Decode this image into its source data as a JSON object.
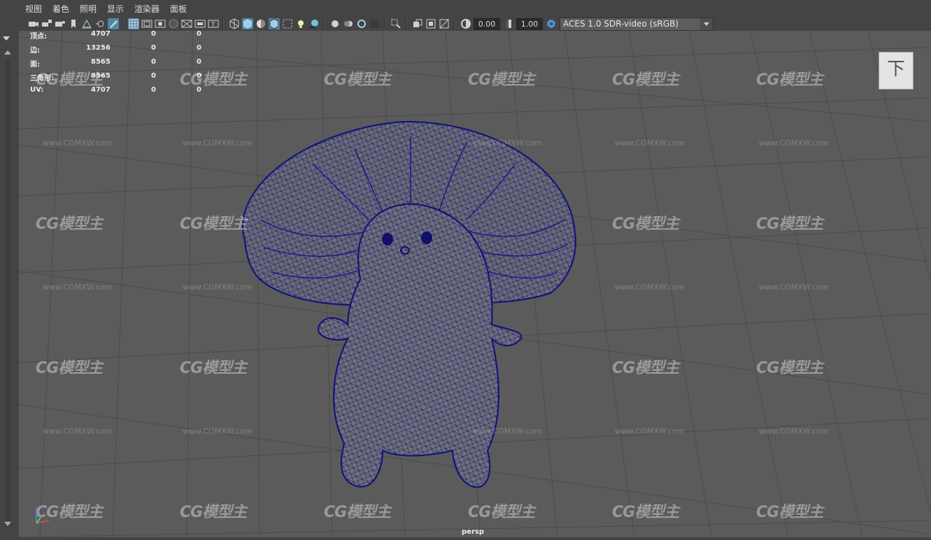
{
  "menubar": {
    "items": [
      "视图",
      "着色",
      "照明",
      "显示",
      "渲染器",
      "面板"
    ]
  },
  "toolbar": {
    "icons": [
      "camera-icon",
      "camera-lock-icon",
      "camera-attributes-icon",
      "bookmark-icon",
      "image-plane-icon",
      "pan-zoom-icon",
      "grease-pencil-icon",
      "grid-icon",
      "film-gate-icon",
      "resolution-gate-icon",
      "gate-mask-icon",
      "field-chart-icon",
      "safe-action-icon",
      "wireframe-icon",
      "smooth-shade-icon",
      "default-material-icon",
      "wireframe-on-shaded-icon",
      "xray-icon",
      "use-all-lights-icon",
      "shadows-icon",
      "screen-space-ao-icon",
      "motion-blur-icon",
      "anti-aliasing-icon",
      "depth-of-field-icon",
      "isolate-select-icon",
      "xray-joints-icon",
      "xray-active-icon",
      "backface-culling-icon",
      "exposure-icon",
      "gamma-icon",
      "color-management-icon"
    ],
    "exposure_value": "0.00",
    "gamma_value": "1.00",
    "color_space": "ACES 1.0 SDR-video (sRGB)"
  },
  "hud": {
    "rows": [
      {
        "label": "顶点:",
        "v1": "4707",
        "v2": "0",
        "v3": "0"
      },
      {
        "label": "边:",
        "v1": "13256",
        "v2": "0",
        "v3": "0"
      },
      {
        "label": "面:",
        "v1": "8565",
        "v2": "0",
        "v3": "0"
      },
      {
        "label": "三角形:",
        "v1": "8565",
        "v2": "0",
        "v3": "0"
      },
      {
        "label": "UV:",
        "v1": "4707",
        "v2": "0",
        "v3": "0"
      }
    ]
  },
  "viewport": {
    "camera_label": "persp",
    "viewcube_label": "下",
    "watermark_logo": "CG模型主",
    "watermark_url": "www.CGMXW.com",
    "wireframe_color": "#1a1a8c"
  },
  "colors": {
    "background": "#444444",
    "viewport_bg": "#5b5b5b",
    "active_button": "#5285a6"
  }
}
